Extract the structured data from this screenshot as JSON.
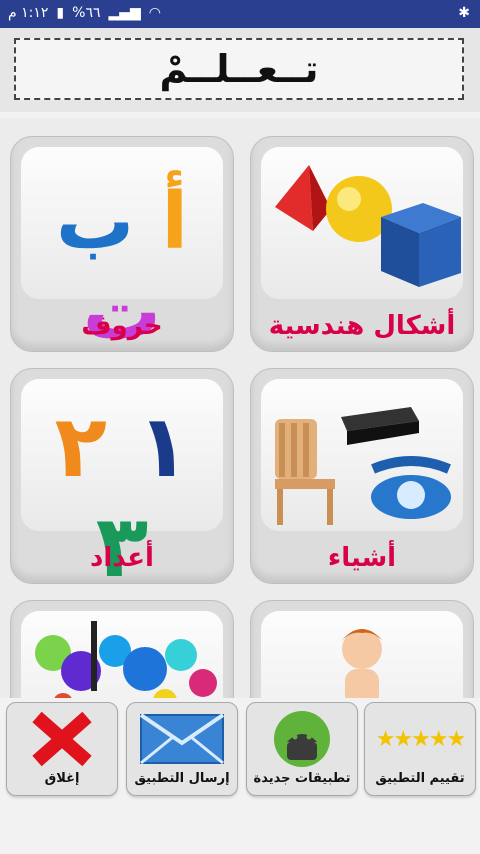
{
  "status": {
    "time": "١:١٢ م",
    "battery": "%٦٦",
    "icons": [
      "bluetooth-icon",
      "wifi-icon",
      "signal-icon",
      "battery-icon"
    ]
  },
  "header": {
    "title": "تــعــلــمْ"
  },
  "tiles": [
    {
      "label": "أشكال هندسية",
      "icon": "geometric-shapes"
    },
    {
      "label": "حروف",
      "icon": "arabic-letters",
      "glyphs": [
        "أ",
        "ب",
        "ت"
      ]
    },
    {
      "label": "أشياء",
      "icon": "objects"
    },
    {
      "label": "أعداد",
      "icon": "arabic-numbers",
      "glyphs": [
        "١",
        "٢",
        "٣"
      ]
    },
    {
      "label": "",
      "icon": "body-boy"
    },
    {
      "label": "",
      "icon": "paint-splash"
    }
  ],
  "bottom_buttons": [
    {
      "label": "تقييم التطبيق",
      "icon": "stars-icon"
    },
    {
      "label": "تطبيقات جديدة",
      "icon": "android-icon"
    },
    {
      "label": "إرسال التطبيق",
      "icon": "envelope-icon"
    },
    {
      "label": "إغلاق",
      "icon": "close-icon"
    }
  ],
  "colors": {
    "statusbar": "#2a3f8f",
    "tile_label": "#d8004a",
    "letter_alif": "#f6a21b",
    "letter_ba": "#1e73c8",
    "letter_ta": "#c83cd8",
    "num_1": "#1a3b8a",
    "num_2": "#f08a1c",
    "num_3": "#1a9a5a"
  }
}
